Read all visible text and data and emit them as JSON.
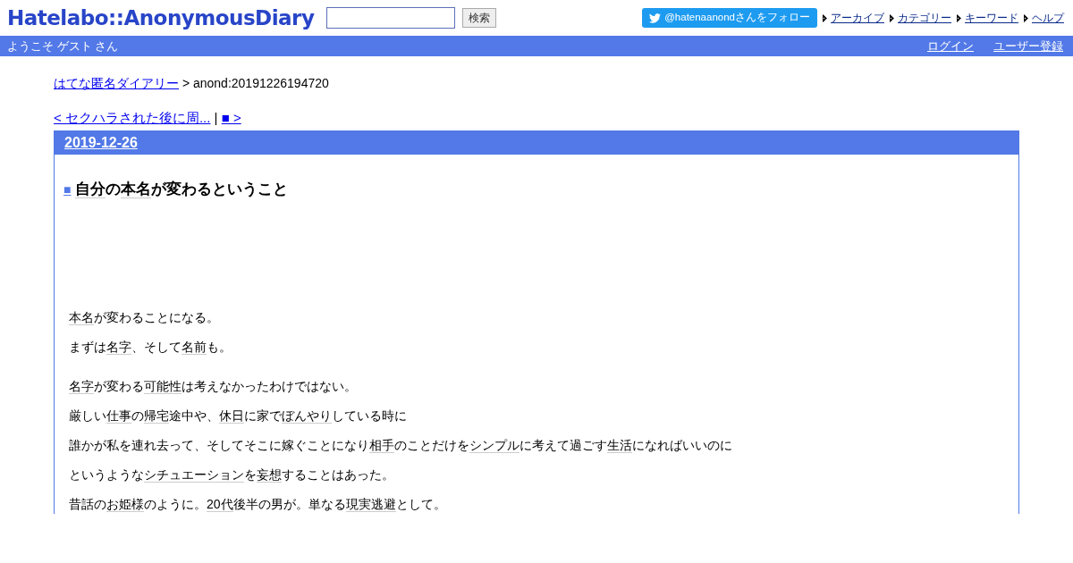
{
  "header": {
    "logo": "Hatelabo::AnonymousDiary",
    "search_button": "検索",
    "follow_button": "@hatenaanondさんをフォロー",
    "links": [
      "アーカイブ",
      "カテゴリー",
      "キーワード",
      "ヘルプ"
    ]
  },
  "userbar": {
    "welcome": "ようこそ ゲスト さん",
    "links": [
      "ログイン",
      "ユーザー登録"
    ]
  },
  "breadcrumb": {
    "link": "はてな匿名ダイアリー",
    "current": "> anond:20191226194720"
  },
  "pager": {
    "prev": "< セクハラされた後に周...",
    "separator": "|",
    "next": "■ >"
  },
  "entry": {
    "date": "2019-12-26",
    "title_mark": "■",
    "title_parts": [
      {
        "text": "自分",
        "link": true
      },
      {
        "text": "の",
        "link": false
      },
      {
        "text": "本名",
        "link": true
      },
      {
        "text": "が変わるということ",
        "link": false
      }
    ],
    "paragraphs": [
      {
        "gap_before": false,
        "parts": [
          {
            "text": "本名",
            "link": true
          },
          {
            "text": "が変わることになる。",
            "link": false
          }
        ]
      },
      {
        "gap_before": false,
        "parts": [
          {
            "text": "まずは",
            "link": false
          },
          {
            "text": "名字",
            "link": true
          },
          {
            "text": "、そして",
            "link": false
          },
          {
            "text": "名前",
            "link": true
          },
          {
            "text": "も。",
            "link": false
          }
        ]
      },
      {
        "gap_before": true,
        "parts": [
          {
            "text": "名字",
            "link": true
          },
          {
            "text": "が変わる",
            "link": false
          },
          {
            "text": "可能性",
            "link": true
          },
          {
            "text": "は考えなかったわけではない。",
            "link": false
          }
        ]
      },
      {
        "gap_before": false,
        "parts": [
          {
            "text": "厳しい",
            "link": false
          },
          {
            "text": "仕事",
            "link": true
          },
          {
            "text": "の",
            "link": false
          },
          {
            "text": "帰宅",
            "link": true
          },
          {
            "text": "途中や、",
            "link": false
          },
          {
            "text": "休日",
            "link": true
          },
          {
            "text": "に家で",
            "link": false
          },
          {
            "text": "ぼんやり",
            "link": true
          },
          {
            "text": "している時に",
            "link": false
          }
        ]
      },
      {
        "gap_before": false,
        "parts": [
          {
            "text": "誰かが私を連れ去って、そしてそこに嫁ぐことになり",
            "link": false
          },
          {
            "text": "相手",
            "link": true
          },
          {
            "text": "のことだけを",
            "link": false
          },
          {
            "text": "シンプル",
            "link": true
          },
          {
            "text": "に考えて過ごす",
            "link": false
          },
          {
            "text": "生活",
            "link": true
          },
          {
            "text": "になればいいのに",
            "link": false
          }
        ]
      },
      {
        "gap_before": false,
        "parts": [
          {
            "text": "というような",
            "link": false
          },
          {
            "text": "シチュエーション",
            "link": true
          },
          {
            "text": "を",
            "link": false
          },
          {
            "text": "妄想",
            "link": true
          },
          {
            "text": "することはあった。",
            "link": false
          }
        ]
      },
      {
        "gap_before": false,
        "parts": [
          {
            "text": "昔話の",
            "link": false
          },
          {
            "text": "お姫様",
            "link": true
          },
          {
            "text": "のように。",
            "link": false
          },
          {
            "text": "20代",
            "link": true
          },
          {
            "text": "後半の男が。単なる",
            "link": false
          },
          {
            "text": "現実逃避",
            "link": true
          },
          {
            "text": "として。",
            "link": false
          }
        ]
      }
    ]
  }
}
